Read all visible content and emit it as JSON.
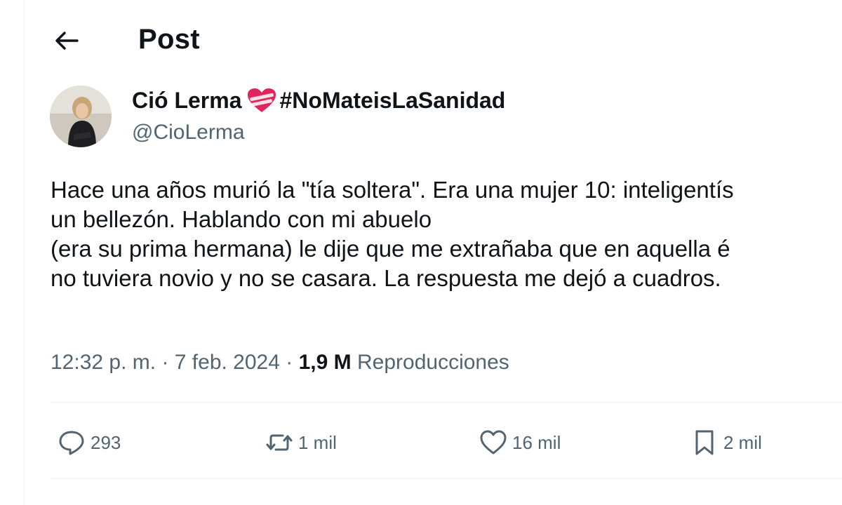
{
  "header": {
    "title": "Post",
    "back_icon": "arrow-left-icon"
  },
  "author": {
    "name": "Ció Lerma",
    "emoji": "bandaged-heart",
    "hashtag": "#NoMateisLaSanidad",
    "handle": "@CioLerma"
  },
  "tweet": {
    "lines": [
      "Hace una años murió la \"tía soltera\". Era una mujer 10: inteligentís",
      "un bellezón. Hablando con mi abuelo",
      "(era su prima hermana) le dije que me extrañaba que en aquella é",
      "no tuviera novio y no se casara. La respuesta me dejó a cuadros."
    ]
  },
  "meta": {
    "time": "12:32 p. m.",
    "sep1": "·",
    "date": "7 feb. 2024",
    "sep2": "·",
    "views": "1,9 M",
    "views_label": "Reproducciones"
  },
  "actions": [
    {
      "icon": "reply-icon",
      "count": "293"
    },
    {
      "icon": "repost-icon",
      "count": "1 mil"
    },
    {
      "icon": "like-icon",
      "count": "16 mil"
    },
    {
      "icon": "bookmark-icon",
      "count": "2 mil"
    }
  ],
  "colors": {
    "text": "#0f1419",
    "secondary": "#536471",
    "divider": "#eff3f4",
    "heart": "#e0245e"
  }
}
